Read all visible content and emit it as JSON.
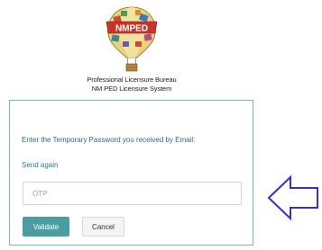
{
  "logo": {
    "text": "NMPED",
    "icon": "hot-air-balloon-logo"
  },
  "header": {
    "line1": "Professional Licensure Bureau",
    "line2": "NM PED Licensure System"
  },
  "form": {
    "prompt": "Enter the Temporary Password you received by Email:",
    "send_again": "Send again",
    "otp_placeholder": "OTP",
    "otp_value": "",
    "validate_label": "Validate",
    "cancel_label": "Cancel"
  },
  "annotation": {
    "icon": "left-arrow-outline-icon",
    "color": "#3333cc"
  },
  "colors": {
    "accent": "#4a9ea3",
    "card_border": "#7bb8bb",
    "link": "#2a7a86"
  }
}
